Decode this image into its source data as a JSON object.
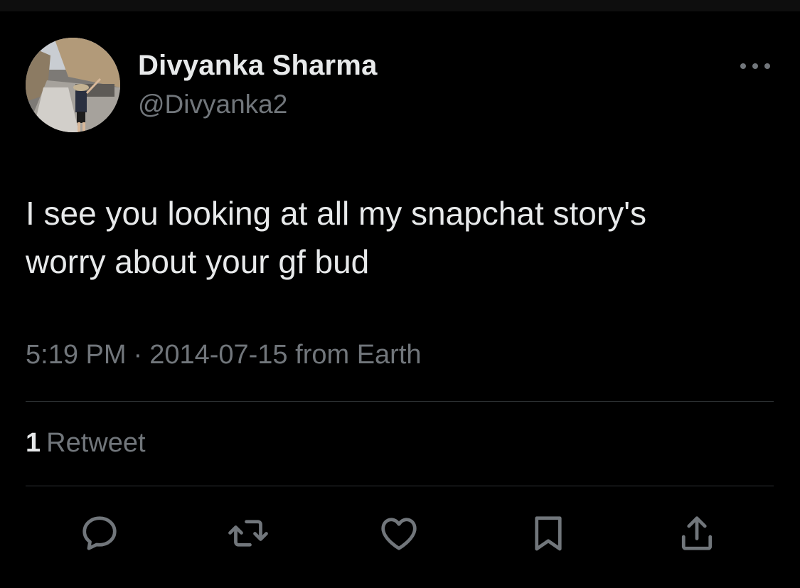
{
  "tweet": {
    "author_name": "Divyanka Sharma",
    "author_handle": "@Divyanka2",
    "text_line1": "I see you looking at all my snapchat story's",
    "text_line2": "worry about your gf bud",
    "time": "5:19 PM",
    "separator": "·",
    "date": "2014-07-15",
    "source": "from Earth"
  },
  "stats": {
    "retweet_count": "1",
    "retweet_label": "Retweet"
  },
  "actions": [
    {
      "name": "reply",
      "icon": "reply-icon"
    },
    {
      "name": "retweet",
      "icon": "retweet-icon"
    },
    {
      "name": "like",
      "icon": "heart-icon"
    },
    {
      "name": "bookmark",
      "icon": "bookmark-icon"
    },
    {
      "name": "share",
      "icon": "share-icon"
    }
  ],
  "colors": {
    "background": "#000000",
    "primary_text": "#e7e9ea",
    "secondary_text": "#71767b",
    "divider": "#2f3336"
  }
}
